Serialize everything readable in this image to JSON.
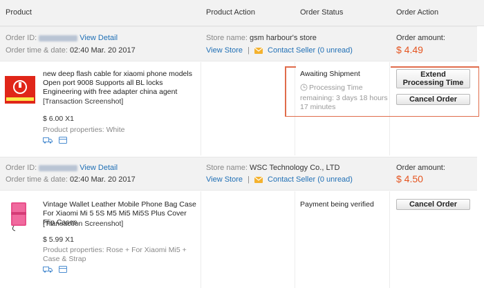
{
  "header": {
    "product": "Product",
    "product_action": "Product Action",
    "order_status": "Order Status",
    "order_action": "Order Action"
  },
  "orders": [
    {
      "order_id_label": "Order ID:",
      "view_detail": "View Detail",
      "order_time_label": "Order time & date:",
      "order_time": "02:40 Mar. 20 2017",
      "store_label": "Store name:",
      "store_name": "gsm harbour's store",
      "view_store": "View Store",
      "contact_seller": "Contact Seller",
      "unread": "(0 unread)",
      "unread_count": "0",
      "amount_label": "Order amount:",
      "amount": "$ 4.49",
      "product_title": "new deep flash cable for xiaomi phone models Open port 9008 Supports all BL locks Engineering with free adapter china agent",
      "transaction_screenshot": "[Transaction Screenshot]",
      "price": "$ 6.00 X1",
      "properties": "Product properties: White",
      "status": "Awaiting Shipment",
      "processing_time": "Processing Time remaining: 3 days 18 hours 17 minutes",
      "buttons": [
        "Extend Processing Time",
        "Cancel Order"
      ]
    },
    {
      "order_id_label": "Order ID:",
      "view_detail": "View Detail",
      "order_time_label": "Order time & date:",
      "order_time": "02:40 Mar. 20 2017",
      "store_label": "Store name:",
      "store_name": "WSC Technology Co., LTD",
      "view_store": "View Store",
      "contact_seller": "Contact Seller",
      "unread": "(0 unread)",
      "amount_label": "Order amount:",
      "amount": "$ 4.50",
      "product_title": "Vintage Wallet Leather Mobile Phone Bag Case For Xiaomi Mi 5 5S M5 Mi5 Mi5S Plus Cover Flip Cases",
      "transaction_screenshot": "[Transaction Screenshot]",
      "price": "$ 5.99 X1",
      "properties": "Product properties: Rose + For Xiaomi Mi5 + Case & Strap",
      "status": "Payment being verified",
      "buttons": [
        "Cancel Order"
      ]
    }
  ],
  "colors": {
    "accent": "#e5541f",
    "link": "#1f6fb5",
    "highlight": "#e06b4a"
  },
  "icons": [
    "shipping-icon",
    "card-icon",
    "envelope-icon",
    "clock-icon"
  ]
}
